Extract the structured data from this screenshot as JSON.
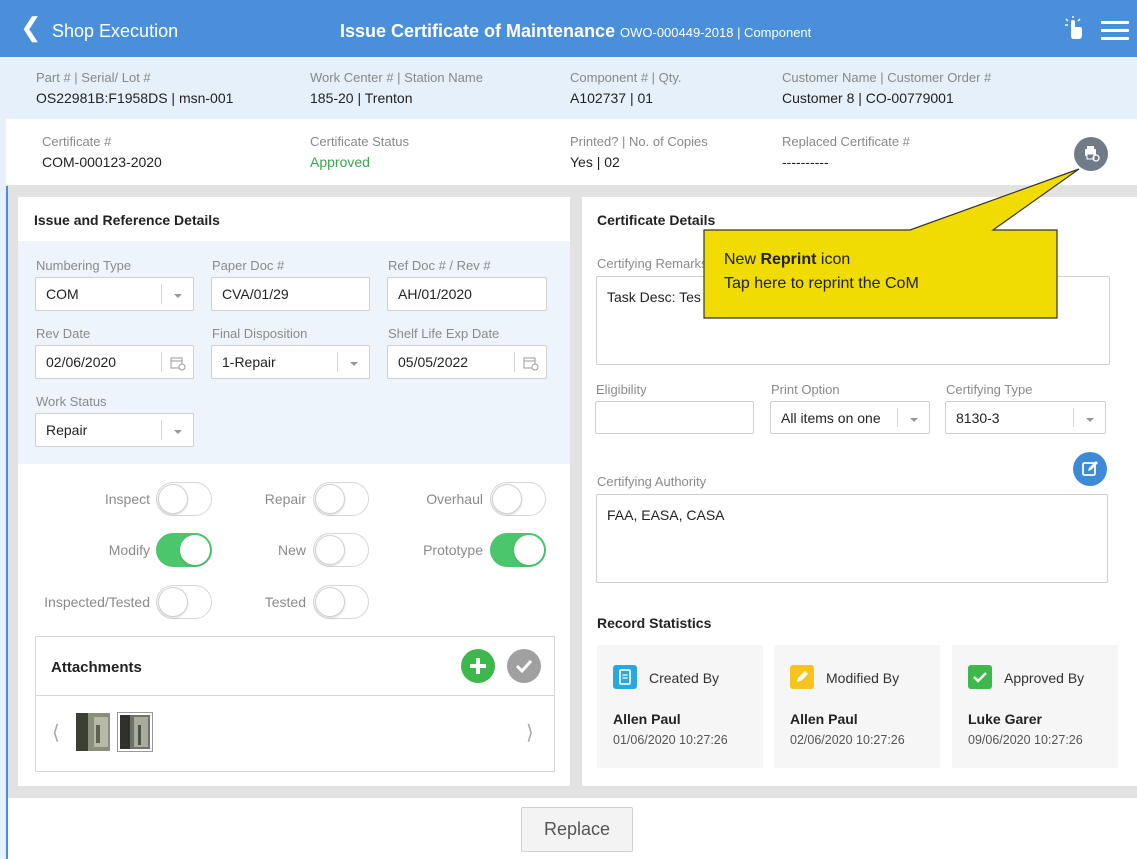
{
  "header": {
    "back_label": "Shop Execution",
    "title": "Issue Certificate of Maintenance",
    "subtitle": "OWO-000449-2018 | Component"
  },
  "info_row1": [
    {
      "label": "Part # | Serial/ Lot #",
      "value": "OS22981B:F1958DS | msn-001"
    },
    {
      "label": "Work Center # | Station Name",
      "value": "185-20 | Trenton"
    },
    {
      "label": "Component # | Qty.",
      "value": "A102737 | 01"
    },
    {
      "label": "Customer Name | Customer Order #",
      "value": "Customer 8 | CO-00779001"
    }
  ],
  "info_row2": [
    {
      "label": "Certificate #",
      "value": "COM-000123-2020"
    },
    {
      "label": "Certificate Status",
      "value": "Approved"
    },
    {
      "label": "Printed? | No. of Copies",
      "value": "Yes | 02"
    },
    {
      "label": "Replaced Certificate #",
      "value": "----------"
    }
  ],
  "issue": {
    "title": "Issue and Reference Details",
    "numbering_type": {
      "label": "Numbering Type",
      "value": "COM"
    },
    "paper_doc": {
      "label": "Paper Doc #",
      "value": "CVA/01/29"
    },
    "ref_doc": {
      "label": "Ref Doc # / Rev #",
      "value": "AH/01/2020"
    },
    "rev_date": {
      "label": "Rev Date",
      "value": "02/06/2020"
    },
    "final_disposition": {
      "label": "Final Disposition",
      "value": "1-Repair"
    },
    "shelf_life": {
      "label": "Shelf Life Exp Date",
      "value": "05/05/2022"
    },
    "work_status": {
      "label": "Work Status",
      "value": "Repair"
    },
    "toggles": {
      "inspect": {
        "label": "Inspect",
        "on": false
      },
      "repair": {
        "label": "Repair",
        "on": false
      },
      "overhaul": {
        "label": "Overhaul",
        "on": false
      },
      "modify": {
        "label": "Modify",
        "on": true
      },
      "new": {
        "label": "New",
        "on": false
      },
      "prototype": {
        "label": "Prototype",
        "on": true
      },
      "inspected_tested": {
        "label": "Inspected/Tested",
        "on": false
      },
      "tested": {
        "label": "Tested",
        "on": false
      }
    },
    "attachments_title": "Attachments"
  },
  "cert": {
    "title": "Certificate Details",
    "remarks_label": "Certifying Remarks",
    "remarks_value": "Task Desc: Tes",
    "eligibility_label": "Eligibility",
    "eligibility_value": "",
    "print_option": {
      "label": "Print Option",
      "value": "All items on one"
    },
    "certifying_type": {
      "label": "Certifying Type",
      "value": "8130-3"
    },
    "authority_label": "Certifying Authority",
    "authority_value": "FAA, EASA, CASA"
  },
  "stats": {
    "title": "Record Statistics",
    "items": [
      {
        "heading": "Created By",
        "name": "Allen Paul",
        "date": "01/06/2020  10:27:26",
        "color": "#29a8e0"
      },
      {
        "heading": "Modified By",
        "name": "Allen Paul",
        "date": "02/06/2020  10:27:26",
        "color": "#f5c51e"
      },
      {
        "heading": "Approved By",
        "name": "Luke Garer",
        "date": "09/06/2020  10:27:26",
        "color": "#3cb94a"
      }
    ]
  },
  "callout": {
    "line1_prefix": "New ",
    "line1_bold": "Reprint",
    "line1_suffix": " icon",
    "line2": "Tap here to reprint the CoM"
  },
  "footer": {
    "replace_label": "Replace"
  },
  "colors": {
    "brand": "#4a8fda",
    "toggle_on": "#4cc66c",
    "approved": "#3aa64a",
    "callout": "#f0dc00"
  }
}
